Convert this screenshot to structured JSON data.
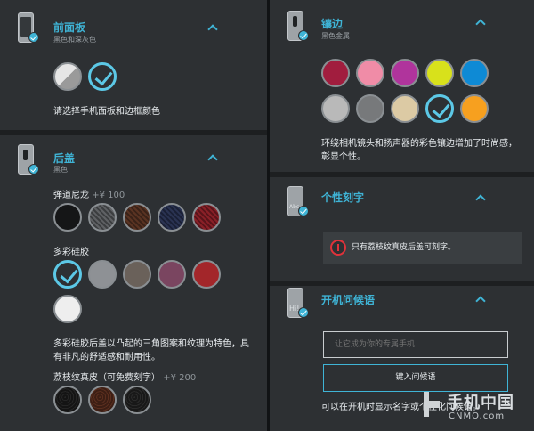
{
  "left_panel": {
    "front": {
      "title": "前面板",
      "subtitle": "黑色和深灰色",
      "hint": "请选择手机面板和边框颜色",
      "swatches": [
        {
          "name": "white-gray",
          "color": "#d8d8d8",
          "selected": false
        },
        {
          "name": "black",
          "color": "#222222",
          "selected": true
        }
      ]
    },
    "back": {
      "title": "后盖",
      "subtitle": "黑色",
      "ballistic": {
        "label": "弹道尼龙",
        "price": "+¥ 100"
      },
      "silicone": {
        "label": "多彩硅胶"
      },
      "silicone_desc": "多彩硅胶后盖以凸起的三角图案和纹理为特色，具有非凡的舒适感和耐用性。",
      "leather": {
        "label": "荔枝纹真皮（可免费刻字）",
        "price": "+¥ 200"
      }
    }
  },
  "right_panel": {
    "accent": {
      "title": "镶边",
      "subtitle": "黑色金属",
      "desc": "环绕相机镜头和扬声器的彩色镶边增加了时尚感，彰显个性。",
      "swatches": [
        {
          "color": "#a11d3e"
        },
        {
          "color": "#f08ca7"
        },
        {
          "color": "#b0349c"
        },
        {
          "color": "#d8e11b"
        },
        {
          "color": "#0e8ad5"
        },
        {
          "color": "#b9b9b9"
        },
        {
          "color": "#77797b"
        },
        {
          "color": "#dccaa4"
        },
        {
          "color": "#222222",
          "selected": true
        },
        {
          "color": "#f7a01f"
        }
      ]
    },
    "engrave": {
      "title": "个性刻字",
      "icon_tag": "Abc",
      "notice": "只有荔枝纹真皮后盖可刻字。"
    },
    "greeting": {
      "title": "开机问候语",
      "icon_tag": "Hi!",
      "input_placeholder": "让它成为你的专属手机",
      "button_label": "键入问候语",
      "desc": "可以在开机时显示名字或个性化问候语。"
    }
  },
  "watermark": {
    "cn": "手机中国",
    "en": "CNMO.com"
  },
  "colors": {
    "accent": "#3fb4d6",
    "panel": "#2d3033",
    "alert": "#e0323a"
  }
}
